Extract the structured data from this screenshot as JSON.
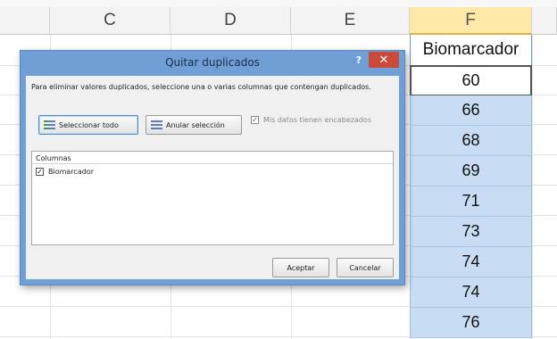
{
  "sheet": {
    "columns": [
      "C",
      "D",
      "E",
      "F"
    ],
    "selected_column": "F",
    "header_cell": "Biomarcador",
    "values": [
      "60",
      "66",
      "68",
      "69",
      "71",
      "73",
      "74",
      "74",
      "76"
    ]
  },
  "dialog": {
    "title": "Quitar duplicados",
    "help_label": "?",
    "close_label": "✕",
    "instructions": "Para eliminar valores duplicados, seleccione una o varias columnas que contengan duplicados.",
    "select_all_label": "Seleccionar todo",
    "unselect_all_label": "Anular selección",
    "headers_checkbox_label": "Mis datos tienen encabezados",
    "columns_header": "Columnas",
    "column_item": "Biomarcador",
    "accept_label": "Aceptar",
    "cancel_label": "Cancelar"
  },
  "colors": {
    "selection_blue": "#c8dcf4",
    "title_bar": "#6f9fd5",
    "close_red": "#c84b3c",
    "selected_column_header": "#fde8a7"
  },
  "icons": [
    "select-all-icon",
    "unselect-all-icon",
    "help-icon",
    "close-icon",
    "checkbox-icon"
  ]
}
